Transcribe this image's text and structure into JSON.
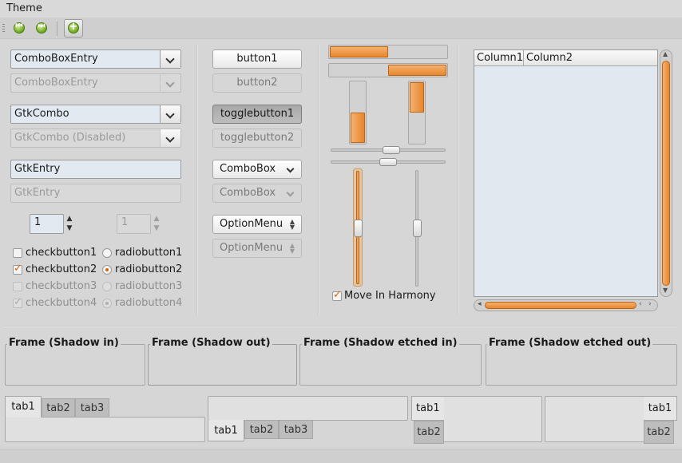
{
  "menubar": {
    "theme": "Theme"
  },
  "toolbar": {
    "icons": [
      "go-first-icon",
      "go-last-icon",
      "add-icon"
    ]
  },
  "col1": {
    "combo_entry": "ComboBoxEntry",
    "combo_entry_dis": "ComboBoxEntry",
    "gtkcombo": "GtkCombo",
    "gtkcombo_dis": "GtkCombo (Disabled)",
    "entry": "GtkEntry",
    "entry_dis": "GtkEntry",
    "spin1": "1",
    "spin2": "1",
    "checks": [
      "checkbutton1",
      "checkbutton2",
      "checkbutton3",
      "checkbutton4"
    ],
    "radios": [
      "radiobutton1",
      "radiobutton2",
      "radiobutton3",
      "radiobutton4"
    ]
  },
  "col2": {
    "button1": "button1",
    "button2": "button2",
    "toggle1": "togglebutton1",
    "toggle2": "togglebutton2",
    "combobox": "ComboBox",
    "combobox_dis": "ComboBox",
    "optionmenu": "OptionMenu",
    "optionmenu_dis": "OptionMenu"
  },
  "col3": {
    "harmony": "Move In Harmony"
  },
  "tree": {
    "col1": "Column1",
    "col2": "Column2"
  },
  "frames": [
    "Frame (Shadow in)",
    "Frame (Shadow out)",
    "Frame (Shadow etched in)",
    "Frame (Shadow etched out)"
  ],
  "notebooks": {
    "nb1": [
      "tab1",
      "tab2",
      "tab3"
    ],
    "nb2": [
      "tab1",
      "tab2",
      "tab3"
    ],
    "nb3": [
      "tab1",
      "tab2"
    ],
    "nb4": [
      "tab1",
      "tab2"
    ]
  },
  "colors": {
    "accent": "#e8862d",
    "entry_bg": "#e3e9f1",
    "window_bg": "#d6d6d6"
  }
}
